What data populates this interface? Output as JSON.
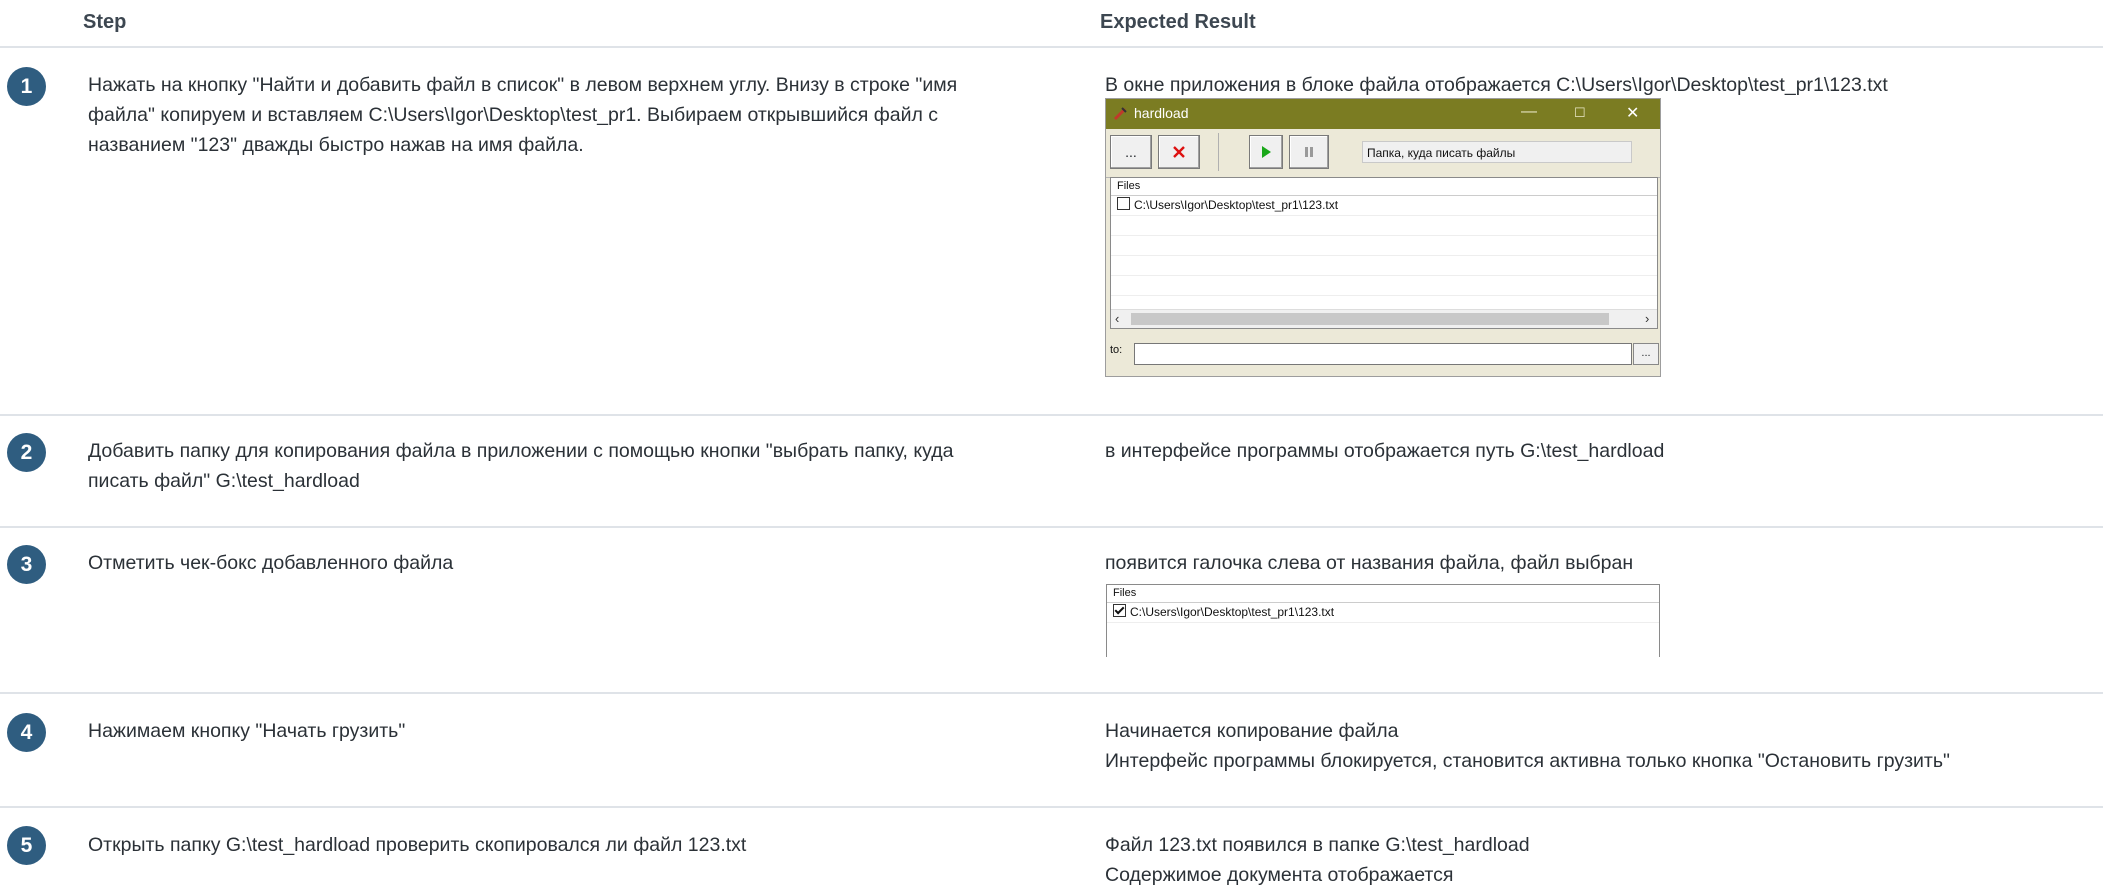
{
  "header": {
    "step_label": "Step",
    "result_label": "Expected Result"
  },
  "rows": [
    {
      "num": "1",
      "step_lines": [
        "Нажать на кнопку \"Найти и добавить файл в список\" в левом верхнем углу. Внизу в строке \"имя",
        "файла\" копируем и вставляем C:\\Users\\Igor\\Desktop\\test_pr1. Выбираем открывшийся файл с",
        "названием \"123\" дважды быстро нажав на имя файла."
      ],
      "result_lines": [
        "В окне приложения в блоке файла отображается C:\\Users\\Igor\\Desktop\\test_pr1\\123.txt"
      ]
    },
    {
      "num": "2",
      "step_lines": [
        "Добавить папку для копирования файла в приложении с помощью кнопки \"выбрать папку, куда",
        "писать файл\" G:\\test_hardload"
      ],
      "result_lines": [
        "в интерфейсе программы отображается путь G:\\test_hardload"
      ]
    },
    {
      "num": "3",
      "step_lines": [
        "Отметить чек-бокс добавленного файла"
      ],
      "result_lines": [
        "появится галочка слева от названия файла, файл выбран"
      ]
    },
    {
      "num": "4",
      "step_lines": [
        "Нажимаем кнопку \"Начать грузить\""
      ],
      "result_lines": [
        "Начинается копирование файла",
        "Интерфейс программы блокируется, становится активна только кнопка \"Остановить грузить\""
      ]
    },
    {
      "num": "5",
      "step_lines": [
        "Открыть папку G:\\test_hardload проверить скопировался ли файл 123.txt"
      ],
      "result_lines": [
        "Файл 123.txt появился в папке G:\\test_hardload",
        "Содержимое документа отображается"
      ]
    }
  ],
  "app_window": {
    "title": "hardload",
    "browse_label": "...",
    "path_placeholder": "Папка, куда писать файлы",
    "files_header": "Files",
    "file_entry": "C:\\Users\\Igor\\Desktop\\test_pr1\\123.txt",
    "to_label": "to:",
    "to_browse_label": "...",
    "icons": {
      "remove": "red-x-icon",
      "start": "play-icon",
      "stop": "pause-icon"
    },
    "colors": {
      "titlebar": "#7b7c22",
      "play": "#1aa81a",
      "remove": "#d11"
    }
  },
  "checked_snippet": {
    "files_header": "Files",
    "file_entry": "C:\\Users\\Igor\\Desktop\\test_pr1\\123.txt",
    "checked": true
  },
  "theme": {
    "badge_color": "#2f5d80",
    "divider_color": "#dfe3e8"
  }
}
